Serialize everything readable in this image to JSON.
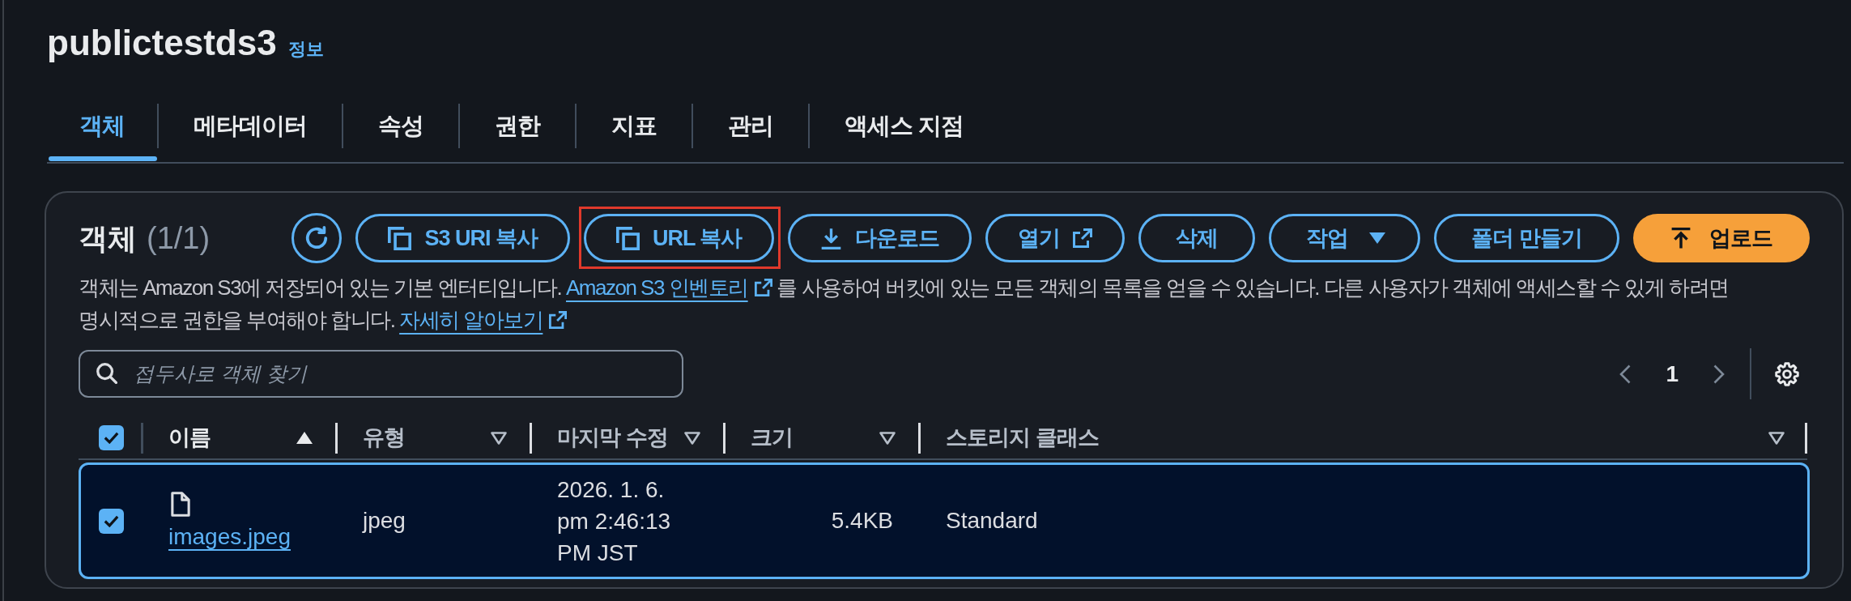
{
  "header": {
    "title": "publictestds3",
    "info_link": "정보"
  },
  "tabs": [
    {
      "label": "객체",
      "selected": true
    },
    {
      "label": "메타데이터",
      "selected": false
    },
    {
      "label": "속성",
      "selected": false
    },
    {
      "label": "권한",
      "selected": false
    },
    {
      "label": "지표",
      "selected": false
    },
    {
      "label": "관리",
      "selected": false
    },
    {
      "label": "액세스 지점",
      "selected": false
    }
  ],
  "objects_container": {
    "title": "객체",
    "count": "(1/1)",
    "buttons": [
      {
        "kind": "refresh",
        "highlighted": false
      },
      {
        "kind": "copy",
        "label": "S3 URI 복사",
        "highlighted": false
      },
      {
        "kind": "copy",
        "label": "URL 복사",
        "highlighted": true
      },
      {
        "kind": "download",
        "label": "다운로드",
        "highlighted": false
      },
      {
        "kind": "open",
        "label": "열기",
        "highlighted": false
      },
      {
        "kind": "plain",
        "label": "삭제",
        "highlighted": false
      },
      {
        "kind": "menu",
        "label": "작업",
        "highlighted": false
      },
      {
        "kind": "plain",
        "label": "폴더 만들기",
        "highlighted": false
      },
      {
        "kind": "upload",
        "label": "업로드",
        "highlighted": false
      }
    ],
    "description": [
      {
        "kind": "text",
        "text": "객체는 Amazon S3에 저장되어 있는 기본 엔터티입니다."
      },
      {
        "kind": "link",
        "text": "Amazon S3 인벤토리",
        "external": true
      },
      {
        "kind": "text",
        "text": "를 사용하여 버킷에 있는 모든 객체의 목록을 얻을 수 있습니다. 다른 사용자가 객체에 액세스할 수 있게 하려면 명시적으로 권한을 부여해야 합니다."
      },
      {
        "kind": "link",
        "text": "자세히 알아보기",
        "external": true
      }
    ],
    "search": {
      "placeholder": "접두사로 객체 찾기"
    },
    "pagination": {
      "current_page": "1",
      "previous_disabled": true,
      "next_disabled": true
    },
    "table": {
      "select_all_checked": true,
      "columns": [
        {
          "label": "이름",
          "sorted": true
        },
        {
          "label": "유형",
          "sorted": false
        },
        {
          "label": "마지막 수정",
          "sorted": false
        },
        {
          "label": "크기",
          "sorted": false
        },
        {
          "label": "스토리지 클래스",
          "sorted": false
        }
      ],
      "rows": [
        {
          "selected": true,
          "checked": true,
          "name": "images.jpeg",
          "type": "jpeg",
          "last_modified": "2026. 1. 6. pm 2:46:13 PM JST",
          "size": "5.4KB",
          "storage_class": "Standard"
        }
      ]
    }
  }
}
